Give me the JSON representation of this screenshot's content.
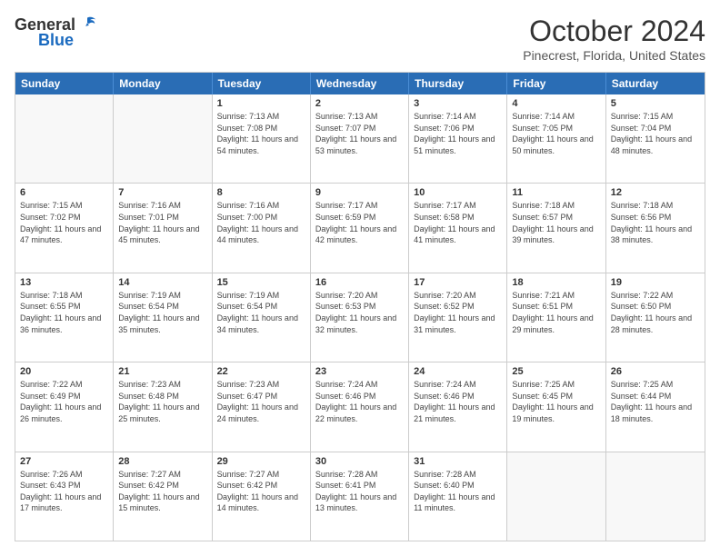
{
  "header": {
    "logo_general": "General",
    "logo_blue": "Blue",
    "month": "October 2024",
    "location": "Pinecrest, Florida, United States"
  },
  "days_of_week": [
    "Sunday",
    "Monday",
    "Tuesday",
    "Wednesday",
    "Thursday",
    "Friday",
    "Saturday"
  ],
  "weeks": [
    [
      {
        "day": "",
        "info": "",
        "empty": true
      },
      {
        "day": "",
        "info": "",
        "empty": true
      },
      {
        "day": "1",
        "info": "Sunrise: 7:13 AM\nSunset: 7:08 PM\nDaylight: 11 hours and 54 minutes."
      },
      {
        "day": "2",
        "info": "Sunrise: 7:13 AM\nSunset: 7:07 PM\nDaylight: 11 hours and 53 minutes."
      },
      {
        "day": "3",
        "info": "Sunrise: 7:14 AM\nSunset: 7:06 PM\nDaylight: 11 hours and 51 minutes."
      },
      {
        "day": "4",
        "info": "Sunrise: 7:14 AM\nSunset: 7:05 PM\nDaylight: 11 hours and 50 minutes."
      },
      {
        "day": "5",
        "info": "Sunrise: 7:15 AM\nSunset: 7:04 PM\nDaylight: 11 hours and 48 minutes."
      }
    ],
    [
      {
        "day": "6",
        "info": "Sunrise: 7:15 AM\nSunset: 7:02 PM\nDaylight: 11 hours and 47 minutes."
      },
      {
        "day": "7",
        "info": "Sunrise: 7:16 AM\nSunset: 7:01 PM\nDaylight: 11 hours and 45 minutes."
      },
      {
        "day": "8",
        "info": "Sunrise: 7:16 AM\nSunset: 7:00 PM\nDaylight: 11 hours and 44 minutes."
      },
      {
        "day": "9",
        "info": "Sunrise: 7:17 AM\nSunset: 6:59 PM\nDaylight: 11 hours and 42 minutes."
      },
      {
        "day": "10",
        "info": "Sunrise: 7:17 AM\nSunset: 6:58 PM\nDaylight: 11 hours and 41 minutes."
      },
      {
        "day": "11",
        "info": "Sunrise: 7:18 AM\nSunset: 6:57 PM\nDaylight: 11 hours and 39 minutes."
      },
      {
        "day": "12",
        "info": "Sunrise: 7:18 AM\nSunset: 6:56 PM\nDaylight: 11 hours and 38 minutes."
      }
    ],
    [
      {
        "day": "13",
        "info": "Sunrise: 7:18 AM\nSunset: 6:55 PM\nDaylight: 11 hours and 36 minutes."
      },
      {
        "day": "14",
        "info": "Sunrise: 7:19 AM\nSunset: 6:54 PM\nDaylight: 11 hours and 35 minutes."
      },
      {
        "day": "15",
        "info": "Sunrise: 7:19 AM\nSunset: 6:54 PM\nDaylight: 11 hours and 34 minutes."
      },
      {
        "day": "16",
        "info": "Sunrise: 7:20 AM\nSunset: 6:53 PM\nDaylight: 11 hours and 32 minutes."
      },
      {
        "day": "17",
        "info": "Sunrise: 7:20 AM\nSunset: 6:52 PM\nDaylight: 11 hours and 31 minutes."
      },
      {
        "day": "18",
        "info": "Sunrise: 7:21 AM\nSunset: 6:51 PM\nDaylight: 11 hours and 29 minutes."
      },
      {
        "day": "19",
        "info": "Sunrise: 7:22 AM\nSunset: 6:50 PM\nDaylight: 11 hours and 28 minutes."
      }
    ],
    [
      {
        "day": "20",
        "info": "Sunrise: 7:22 AM\nSunset: 6:49 PM\nDaylight: 11 hours and 26 minutes."
      },
      {
        "day": "21",
        "info": "Sunrise: 7:23 AM\nSunset: 6:48 PM\nDaylight: 11 hours and 25 minutes."
      },
      {
        "day": "22",
        "info": "Sunrise: 7:23 AM\nSunset: 6:47 PM\nDaylight: 11 hours and 24 minutes."
      },
      {
        "day": "23",
        "info": "Sunrise: 7:24 AM\nSunset: 6:46 PM\nDaylight: 11 hours and 22 minutes."
      },
      {
        "day": "24",
        "info": "Sunrise: 7:24 AM\nSunset: 6:46 PM\nDaylight: 11 hours and 21 minutes."
      },
      {
        "day": "25",
        "info": "Sunrise: 7:25 AM\nSunset: 6:45 PM\nDaylight: 11 hours and 19 minutes."
      },
      {
        "day": "26",
        "info": "Sunrise: 7:25 AM\nSunset: 6:44 PM\nDaylight: 11 hours and 18 minutes."
      }
    ],
    [
      {
        "day": "27",
        "info": "Sunrise: 7:26 AM\nSunset: 6:43 PM\nDaylight: 11 hours and 17 minutes."
      },
      {
        "day": "28",
        "info": "Sunrise: 7:27 AM\nSunset: 6:42 PM\nDaylight: 11 hours and 15 minutes."
      },
      {
        "day": "29",
        "info": "Sunrise: 7:27 AM\nSunset: 6:42 PM\nDaylight: 11 hours and 14 minutes."
      },
      {
        "day": "30",
        "info": "Sunrise: 7:28 AM\nSunset: 6:41 PM\nDaylight: 11 hours and 13 minutes."
      },
      {
        "day": "31",
        "info": "Sunrise: 7:28 AM\nSunset: 6:40 PM\nDaylight: 11 hours and 11 minutes."
      },
      {
        "day": "",
        "info": "",
        "empty": true
      },
      {
        "day": "",
        "info": "",
        "empty": true
      }
    ]
  ]
}
